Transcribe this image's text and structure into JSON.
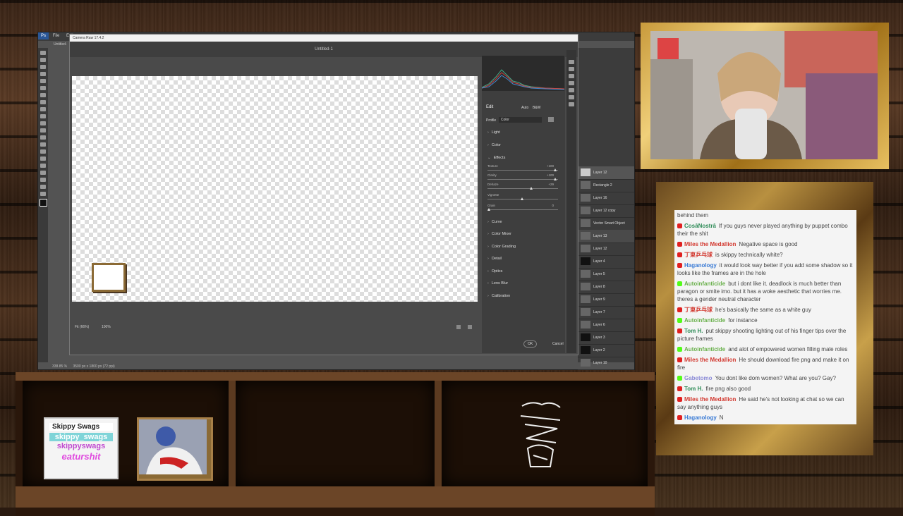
{
  "photoshop": {
    "menu": [
      "Ps",
      "File",
      "Edit"
    ],
    "tab": "Untitled-",
    "status": "338.85 %",
    "doc_info": "3500 px x 1800 px (72 ppi)",
    "layers": [
      "Layer 12",
      "Rectangle 2",
      "Layer 16",
      "Layer 12 copy",
      "Vector Smart Object",
      "Layer 13",
      "Layer 12",
      "Layer 4",
      "Layer 5",
      "Layer 8",
      "Layer 9",
      "Layer 7",
      "Layer 6",
      "Layer 3",
      "Layer 2",
      "Layer 10"
    ]
  },
  "camera_raw": {
    "title": "Camera Raw 17.4.2",
    "document": "Untitled-1",
    "edit_label": "Edit",
    "auto_label": "Auto",
    "bw_label": "B&W",
    "profile_label": "Profile",
    "profile_value": "Color",
    "zoom_fit": "Fit (66%)",
    "zoom_100": "100%",
    "ok_label": "OK",
    "cancel_label": "Cancel",
    "sections_top": [
      "Light",
      "Color",
      "Effects"
    ],
    "sliders": [
      {
        "label": "Texture",
        "value": "+100",
        "fraction": 1.0
      },
      {
        "label": "Clarity",
        "value": "+100",
        "fraction": 1.0
      },
      {
        "label": "Dehaze",
        "value": "+29",
        "fraction": 0.64
      },
      {
        "label": "Vignette",
        "value": "",
        "fraction": 0.5
      },
      {
        "label": "Grain",
        "value": "0",
        "fraction": 0.0
      }
    ],
    "sections_bottom": [
      "Curve",
      "Color Mixer",
      "Color Grading",
      "Detail",
      "Optics",
      "Lens Blur",
      "Calibration"
    ]
  },
  "chat": {
    "messages": [
      {
        "user": "",
        "text": "behind them",
        "color": "#444444",
        "badge": ""
      },
      {
        "user": "CosâNostrâ",
        "text": "If you guys never played anything by puppet combo their the shit",
        "color": "#2e8b57",
        "badge": "red"
      },
      {
        "user": "Miles the Medallion",
        "text": "Negative space is good",
        "color": "#d2382f",
        "badge": "red"
      },
      {
        "user": "丁東乒乓球",
        "text": "is skippy technically white?",
        "color": "#d2382f",
        "badge": "red"
      },
      {
        "user": "Haganology",
        "text": "it would look way better if you add some shadow so it looks like the frames are in the hole",
        "color": "#3a7bd5",
        "badge": "red"
      },
      {
        "user": "Autoinfanticide",
        "text": "but i dont like it. deadlock is much better than paragon or smite imo. but it has a woke aesthetic that worries me. theres a gender neutral character",
        "color": "#6ab04c",
        "badge": "green"
      },
      {
        "user": "丁東乒乓球",
        "text": "he's basically the same as a white guy",
        "color": "#d2382f",
        "badge": "red"
      },
      {
        "user": "Autoinfanticide",
        "text": "for instance",
        "color": "#6ab04c",
        "badge": "green"
      },
      {
        "user": "Tom H.",
        "text": "put skippy shooting lighting out of his finger tips over the picture frames",
        "color": "#2e8b57",
        "badge": "red"
      },
      {
        "user": "Autoinfanticide",
        "text": "and alot of empowered women filling male roles",
        "color": "#6ab04c",
        "badge": "green"
      },
      {
        "user": "Miles the Medallion",
        "text": "He should download fire png and make it on fire",
        "color": "#d2382f",
        "badge": "red"
      },
      {
        "user": "Gabetomo",
        "text": "You dont like dom women? What are you? Gay?",
        "color": "#8a8ad6",
        "badge": "green"
      },
      {
        "user": "Tom H.",
        "text": "fire png also good",
        "color": "#2e8b57",
        "badge": "red"
      },
      {
        "user": "Miles the Medallion",
        "text": "He said he's not looking at chat so we can say anything guys",
        "color": "#d2382f",
        "badge": "red"
      },
      {
        "user": "Haganology",
        "text": "N",
        "color": "#3a7bd5",
        "badge": "red"
      }
    ]
  },
  "shelf": {
    "sticker_title": "Skippy Swags",
    "sticker_line1": "skippy_swags",
    "sticker_line2": "skippyswags",
    "sticker_line3": "eaturshit"
  },
  "colors": {
    "wood_dark": "#2a170b",
    "wood_light": "#6b4527",
    "gold_frame": "#c89a3c"
  }
}
